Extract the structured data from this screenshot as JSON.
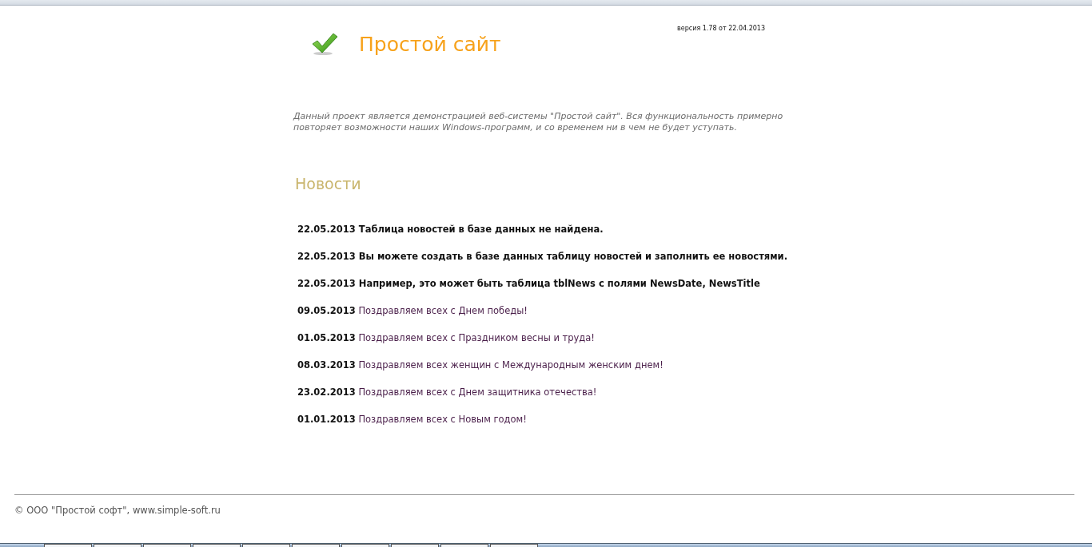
{
  "header": {
    "title": "Простой сайт",
    "version": "версия 1.78 от 22.04.2013"
  },
  "intro": "Данный проект является демонстрацией веб-системы \"Простой сайт\". Вся функциональность примерно повторяет возможности наших Windows-программ, и со временем ни в чем не будет уступать.",
  "news": {
    "heading": "Новости",
    "items": [
      {
        "date": "22.05.2013",
        "title": "Таблица новостей в базе данных не найдена.",
        "bold": true
      },
      {
        "date": "22.05.2013",
        "title": "Вы можете создать в базе данных таблицу новостей и заполнить ее новостями.",
        "bold": true
      },
      {
        "date": "22.05.2013",
        "title": "Например, это может быть таблица tblNews с полями NewsDate, NewsTitle",
        "bold": true
      },
      {
        "date": "09.05.2013",
        "title": "Поздравляем всех с Днем победы!",
        "bold": false
      },
      {
        "date": "01.05.2013",
        "title": "Поздравляем всех с Праздником весны и труда!",
        "bold": false
      },
      {
        "date": "08.03.2013",
        "title": "Поздравляем всех женщин с Международным женским днем!",
        "bold": false
      },
      {
        "date": "23.02.2013",
        "title": "Поздравляем всех с Днем защитника отечества!",
        "bold": false
      },
      {
        "date": "01.01.2013",
        "title": "Поздравляем всех с Новым годом!",
        "bold": false
      }
    ]
  },
  "footer": {
    "copyright": "© ООО \"Простой софт\", www.simple-soft.ru"
  }
}
